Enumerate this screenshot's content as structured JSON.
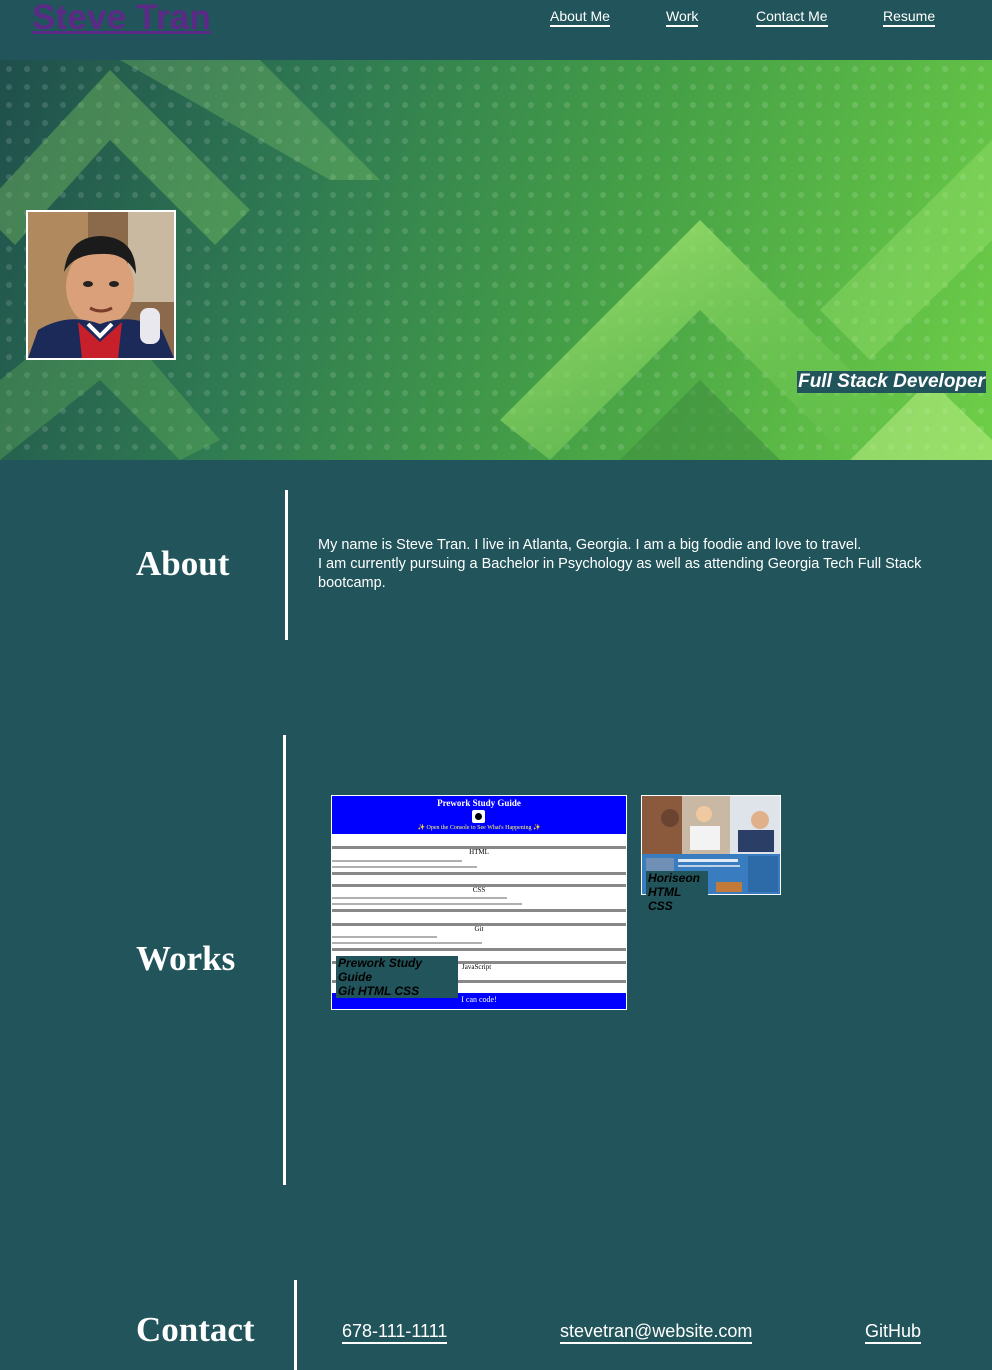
{
  "header": {
    "brand": "Steve Tran",
    "nav": [
      "About Me",
      "Work",
      "Contact Me",
      "Resume"
    ]
  },
  "hero": {
    "tagline": "Full Stack Developer",
    "avatar_icon": "profile-photo"
  },
  "about": {
    "title": "About",
    "line1": "My name is Steve Tran. I live in Atlanta, Georgia. I am a big foodie and love to travel.",
    "line2": "I am currently pursuing a Bachelor in Psychology as well as attending Georgia Tech Full Stack bootcamp."
  },
  "works": {
    "title": "Works",
    "items": [
      {
        "caption_line1": "Prework Study Guide",
        "caption_line2": "Git HTML CSS",
        "thumb": {
          "title": "Prework Study Guide",
          "subtitle": "✨ Open the Console to See What's Happening ✨",
          "sections": [
            "HTML",
            "CSS",
            "Git",
            "JavaScript"
          ],
          "footer": "I can code!"
        }
      },
      {
        "caption_line1": "Horiseon",
        "caption_line2": "HTML CSS"
      }
    ]
  },
  "contact": {
    "title": "Contact",
    "phone": "678-111-1111",
    "email": "stevetran@website.com",
    "github": "GitHub"
  },
  "colors": {
    "background": "#22555b",
    "brand_link": "#5b2a86",
    "text": "#ffffff"
  }
}
